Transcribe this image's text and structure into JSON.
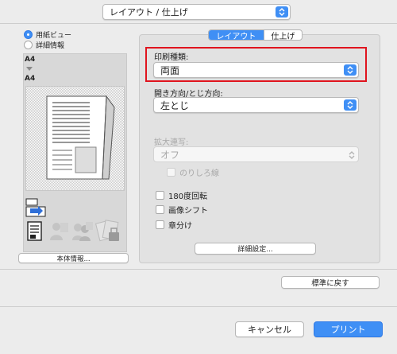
{
  "header": {
    "panel_select_value": "レイアウト / 仕上げ"
  },
  "preview": {
    "view_options": [
      {
        "label": "用紙ビュー",
        "selected": true
      },
      {
        "label": "詳細情報",
        "selected": false
      }
    ],
    "paper_from": "A4",
    "paper_to": "A4",
    "device_info_button": "本体情報..."
  },
  "tabs": [
    {
      "label": "レイアウト",
      "active": true
    },
    {
      "label": "仕上げ",
      "active": false
    }
  ],
  "layout": {
    "print_type": {
      "label": "印刷種類:",
      "value": "両面"
    },
    "binding": {
      "label": "開き方向/とじ方向:",
      "value": "左とじ"
    },
    "enlarge": {
      "label": "拡大連写:",
      "value": "オフ",
      "enabled": false
    },
    "margin_line": {
      "label": "のりしろ線",
      "checked": false,
      "enabled": false
    },
    "rotate180": {
      "label": "180度回転",
      "checked": false
    },
    "image_shift": {
      "label": "画像シフト",
      "checked": false
    },
    "chapter": {
      "label": "章分け",
      "checked": false
    },
    "detail_button": "詳細設定..."
  },
  "footer": {
    "reset_button": "標準に戻す",
    "cancel_button": "キャンセル",
    "print_button": "プリント"
  },
  "colors": {
    "accent": "#3f8ff5",
    "highlight": "#e0141e"
  }
}
